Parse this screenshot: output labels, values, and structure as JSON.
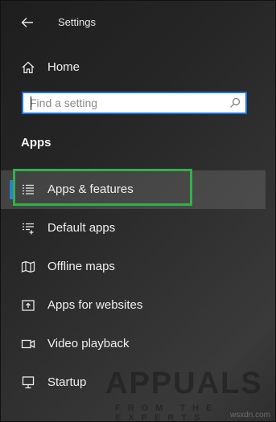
{
  "window": {
    "title": "Settings"
  },
  "home": {
    "label": "Home"
  },
  "search": {
    "placeholder": "Find a setting",
    "value": ""
  },
  "section": {
    "heading": "Apps"
  },
  "nav": {
    "items": [
      {
        "label": "Apps & features",
        "icon": "list-icon",
        "selected": true
      },
      {
        "label": "Default apps",
        "icon": "default-apps-icon",
        "selected": false
      },
      {
        "label": "Offline maps",
        "icon": "map-icon",
        "selected": false
      },
      {
        "label": "Apps for websites",
        "icon": "open-link-icon",
        "selected": false
      },
      {
        "label": "Video playback",
        "icon": "video-icon",
        "selected": false
      },
      {
        "label": "Startup",
        "icon": "monitor-icon",
        "selected": false
      }
    ]
  },
  "branding": {
    "logo_text": "APPUALS",
    "logo_subtext": "FROM THE EXPERTS",
    "watermark": "wsxdn.com"
  },
  "colors": {
    "accent": "#2d7dd2",
    "highlight": "#32b04a",
    "search_border": "#1a73e8"
  }
}
